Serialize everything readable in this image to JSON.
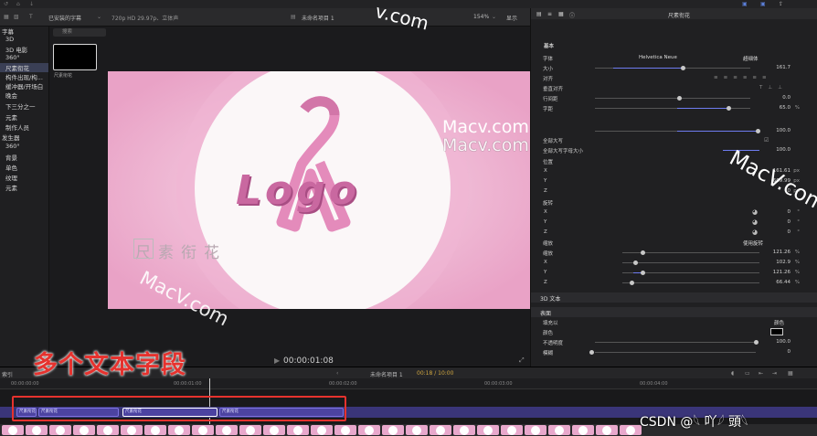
{
  "toolbar": {
    "library_label": "已安装的字幕",
    "format_label": "720p HD 29.97p、立体声",
    "project_name": "未命名项目 1",
    "zoom": "154%",
    "view_menu": "显示",
    "inspector_title": "尺素衔花"
  },
  "sidebar": {
    "items": [
      "字幕",
      "3D",
      "3D 电影",
      "360°",
      "尺素衔花",
      "构件出现/构...",
      "缓冲器/开场白",
      "晚会",
      "下三分之一",
      "元素",
      "制作人员",
      "发生器",
      "360°",
      "背景",
      "单色",
      "纹理",
      "元素"
    ]
  },
  "browser": {
    "search_placeholder": "搜索",
    "thumb_label": "尺素衔花"
  },
  "canvas": {
    "logo_text": "Logo",
    "subtitle_text": "尺素衔花"
  },
  "transport": {
    "timecode": "00:00:01:08"
  },
  "inspector": {
    "section_basic": "基本",
    "font_label": "字体",
    "font_value": "Helvetica Neue",
    "font_style": "超细体",
    "size_label": "大小",
    "size_value": "161.7",
    "align_label": "对齐",
    "vertical_align_label": "垂直对齐",
    "line_spacing_label": "行间距",
    "line_spacing_value": "0.0",
    "tracking_label": "字距",
    "tracking_value": "65.0",
    "tracking_unit": "%",
    "baseline_value": "100.0",
    "all_caps_label": "全部大写",
    "all_caps_size_label": "全部大写字母大小",
    "all_caps_size_value": "100.0",
    "position_label": "位置",
    "pos_x": "161.61",
    "pos_y": "-669.99",
    "pos_z": "0",
    "pos_unit": "px",
    "rotation_label": "旋转",
    "rot_x": "0",
    "rot_y": "0",
    "rot_z": "0",
    "rot_unit": "°",
    "scale_label": "缩放",
    "scale_mode": "使用旋转",
    "scale_all_label": "缩放",
    "scale_all": "121.26",
    "scale_x": "102.9",
    "scale_y": "121.26",
    "scale_z": "66.44",
    "scale_unit": "%",
    "text3d_label": "3D 文本",
    "face_label": "表面",
    "fill_label": "填充以",
    "fill_value": "颜色",
    "color_label": "颜色",
    "opacity_label": "不透明度",
    "opacity_value": "100.0",
    "blur_label": "模糊",
    "blur_value": "0"
  },
  "timeline": {
    "index_label": "索引",
    "project_name": "未命名项目 1",
    "duration": "00:18 / 10:00",
    "ruler": [
      "00:00:00:00",
      "00:00:01:00",
      "00:00:02:00",
      "00:00:03:00",
      "00:00:04:00"
    ],
    "clips": [
      "尺素衔花",
      "尺素衔花",
      "尺素衔花",
      "尺素衔花",
      "尺素衔花"
    ]
  },
  "annotation": {
    "callout": "多个文本字段",
    "callout_color": "#e6322e"
  },
  "watermarks": [
    "Macv.com",
    "Macv.com",
    "MacV.com",
    "MacV.com",
    "v.com"
  ],
  "credit": "CSDN @𓆩 吖𓆪 頭𓆩"
}
